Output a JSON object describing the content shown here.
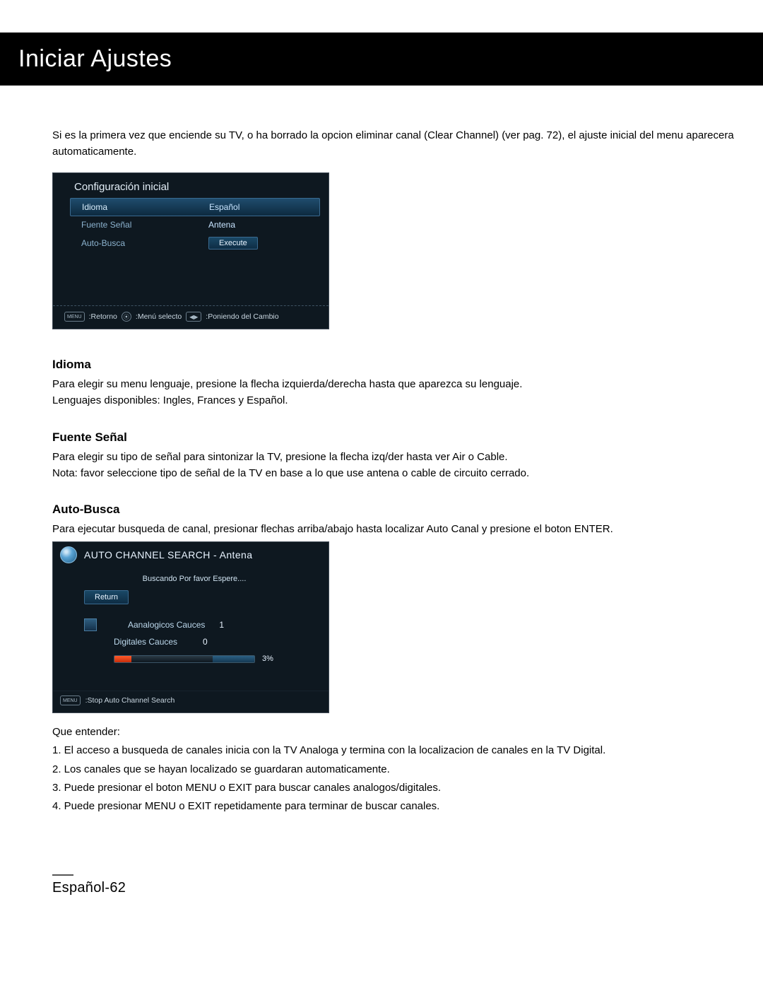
{
  "header": {
    "title": "Iniciar Ajustes"
  },
  "intro": "Si es la primera vez que enciende su TV, o ha borrado la opcion eliminar canal (Clear Channel) (ver pag. 72), el ajuste inicial del menu aparecera automaticamente.",
  "osd1": {
    "title": "Configuración inicial",
    "rows": [
      {
        "label": "Idioma",
        "value": "Español"
      },
      {
        "label": "Fuente Señal",
        "value": "Antena"
      },
      {
        "label": "Auto-Busca",
        "value": "Execute"
      }
    ],
    "hints": {
      "menu_chip": "MENU",
      "retorno": ":Retorno",
      "menu_selecto": ":Menú selecto",
      "cambio": ":Poniendo del Cambio"
    }
  },
  "sections": {
    "idioma": {
      "title": "Idioma",
      "body_line1": "Para elegir su menu lenguaje, presione la flecha izquierda/derecha hasta que aparezca su lenguaje.",
      "body_line2": "Lenguajes disponibles: Ingles, Frances y Español."
    },
    "fuente": {
      "title": "Fuente Señal",
      "body_line1": "Para elegir su tipo de señal para sintonizar la TV, presione la flecha izq/der hasta ver Air o Cable.",
      "body_line2": "Nota: favor seleccione tipo de señal de la TV en base a lo que use antena o cable de circuito cerrado."
    },
    "auto": {
      "title": "Auto-Busca",
      "body_line1": "Para ejecutar busqueda de canal, presionar flechas arriba/abajo hasta localizar Auto Canal y presione el boton ENTER."
    }
  },
  "osd2": {
    "title": "AUTO CHANNEL SEARCH - Antena",
    "message": "Buscando Por favor Espere....",
    "return_label": "Return",
    "analog_label": "Aanalogicos Cauces",
    "analog_count": "1",
    "digital_label": "Digitales Cauces",
    "digital_count": "0",
    "percent": "3%",
    "footer_chip": "MENU",
    "footer_text": ":Stop Auto Channel Search"
  },
  "notes": {
    "header": "Que entender:",
    "items": [
      "1. El acceso a busqueda de canales inicia con la TV Analoga y termina con la localizacion de canales en la TV Digital.",
      "2. Los canales que se hayan localizado se guardaran automaticamente.",
      "3. Puede presionar el boton MENU o EXIT para buscar canales analogos/digitales.",
      "4. Puede presionar MENU o EXIT repetidamente para terminar de buscar canales."
    ]
  },
  "footer": {
    "page": "Español-62"
  },
  "chart_data": {
    "type": "table",
    "title": "Auto Channel Search progress",
    "rows": [
      {
        "label": "Aanalogicos Cauces",
        "value": 1
      },
      {
        "label": "Digitales Cauces",
        "value": 0
      }
    ],
    "progress_percent": 3
  }
}
